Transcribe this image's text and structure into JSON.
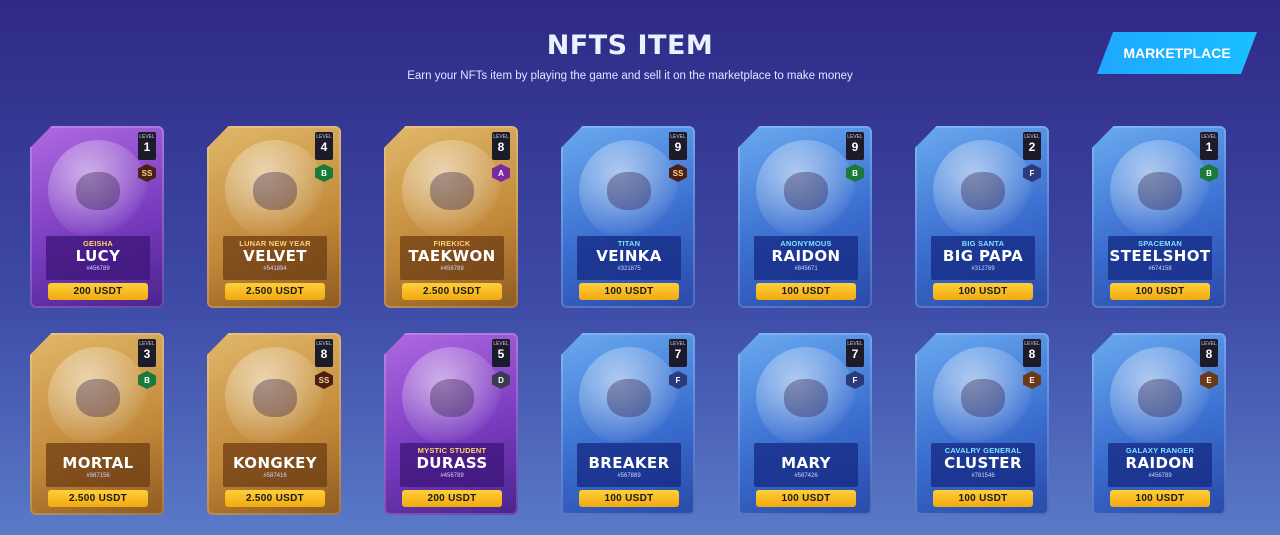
{
  "header": {
    "title": "NFTS ITEM",
    "subtitle": "Earn your NFTs item by playing the game and sell it on the marketplace to make money",
    "marketplace_label": "MARKETPLACE"
  },
  "level_caption": "LEVEL",
  "rows": [
    [
      {
        "class": "GEISHA",
        "name": "LUCY",
        "id": "#456789",
        "price": "200 USDT",
        "level": "1",
        "grade": "SS",
        "rarity": "purple"
      },
      {
        "class": "LUNAR NEW YEAR",
        "name": "VELVET",
        "id": "#541894",
        "price": "2.500 USDT",
        "level": "4",
        "grade": "B",
        "rarity": "gold"
      },
      {
        "class": "FIREKICK",
        "name": "TAEKWON",
        "id": "#456789",
        "price": "2.500 USDT",
        "level": "8",
        "grade": "A",
        "rarity": "gold"
      },
      {
        "class": "TITAN",
        "name": "VEINKA",
        "id": "#321875",
        "price": "100 USDT",
        "level": "9",
        "grade": "SS",
        "rarity": "blue"
      },
      {
        "class": "ANONYMOUS",
        "name": "RAIDON",
        "id": "#845671",
        "price": "100 USDT",
        "level": "9",
        "grade": "B",
        "rarity": "blue"
      },
      {
        "class": "BIG SANTA",
        "name": "BIG PAPA",
        "id": "#312789",
        "price": "100 USDT",
        "level": "2",
        "grade": "F",
        "rarity": "blue"
      },
      {
        "class": "SPACEMAN",
        "name": "STEELSHOT",
        "id": "#674158",
        "price": "100 USDT",
        "level": "1",
        "grade": "B",
        "rarity": "blue"
      }
    ],
    [
      {
        "class": "",
        "name": "MORTAL",
        "id": "#987156",
        "price": "2.500 USDT",
        "level": "3",
        "grade": "B",
        "rarity": "gold"
      },
      {
        "class": "",
        "name": "KONGKEY",
        "id": "#587416",
        "price": "2.500 USDT",
        "level": "8",
        "grade": "SS",
        "rarity": "gold"
      },
      {
        "class": "MYSTIC STUDENT",
        "name": "DURASS",
        "id": "#456789",
        "price": "200 USDT",
        "level": "5",
        "grade": "D",
        "rarity": "purple"
      },
      {
        "class": "",
        "name": "BREAKER",
        "id": "#567889",
        "price": "100 USDT",
        "level": "7",
        "grade": "F",
        "rarity": "blue"
      },
      {
        "class": "",
        "name": "MARY",
        "id": "#587426",
        "price": "100 USDT",
        "level": "7",
        "grade": "F",
        "rarity": "blue"
      },
      {
        "class": "CAVALRY GENERAL",
        "name": "CLUSTER",
        "id": "#781546",
        "price": "100 USDT",
        "level": "8",
        "grade": "E",
        "rarity": "blue"
      },
      {
        "class": "GALAXY RANGER",
        "name": "RAIDON",
        "id": "#456789",
        "price": "100 USDT",
        "level": "8",
        "grade": "E",
        "rarity": "blue"
      }
    ]
  ]
}
